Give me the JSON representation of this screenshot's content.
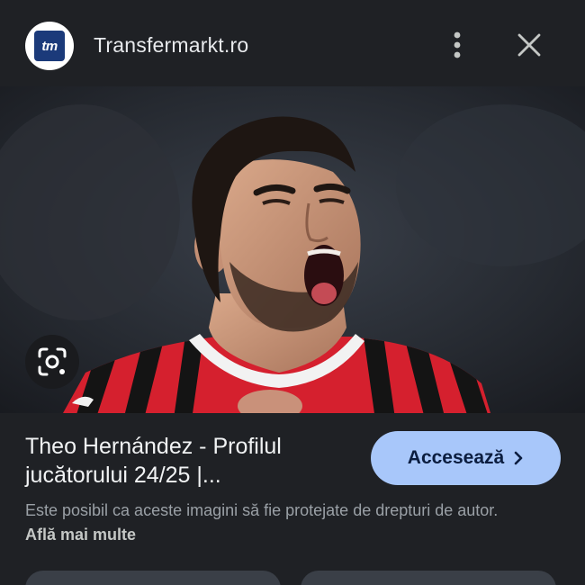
{
  "header": {
    "logo_text": "tm",
    "site_name": "Transfermarkt.ro",
    "more_icon": "vertical-dots-icon",
    "close_icon": "close-icon"
  },
  "image": {
    "description_icon": "photo",
    "lens_icon": "lens-icon"
  },
  "details": {
    "title": "Theo Hernández - Profilul jucătorului 24/25 |...",
    "visit_label": "Accesează",
    "visit_icon": "chevron-right-icon",
    "copyright_text": "Este posibil ca aceste imagini să fie protejate de drepturi de autor.",
    "learn_more_label": "Află mai multe"
  },
  "colors": {
    "background": "#1f2125",
    "button_accent": "#a8c7fa",
    "jersey_red": "#d5202e"
  }
}
